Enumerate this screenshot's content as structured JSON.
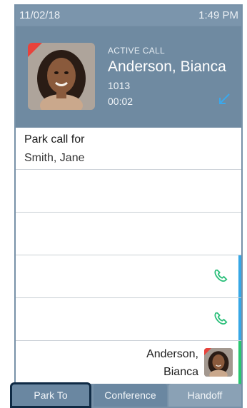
{
  "status_bar": {
    "date": "11/02/18",
    "time": "1:49 PM"
  },
  "active_call": {
    "state_label": "ACTIVE CALL",
    "name": "Anderson, Bianca",
    "extension": "1013",
    "duration": "00:02"
  },
  "park": {
    "title": "Park call for",
    "target": "Smith, Jane"
  },
  "rows": [
    {
      "type": "empty"
    },
    {
      "type": "empty"
    },
    {
      "type": "call",
      "accent": "#37a7e6"
    },
    {
      "type": "call",
      "accent": "#37a7e6"
    },
    {
      "type": "contact",
      "name_line1": "Anderson,",
      "name_line2": "Bianca",
      "accent": "#28c76f"
    }
  ],
  "softkeys": [
    "Park To",
    "Conference",
    "Handoff"
  ],
  "colors": {
    "phone_green": "#2bbf7a",
    "incoming_blue": "#3aa8ec",
    "presence_red": "#e8423b"
  }
}
